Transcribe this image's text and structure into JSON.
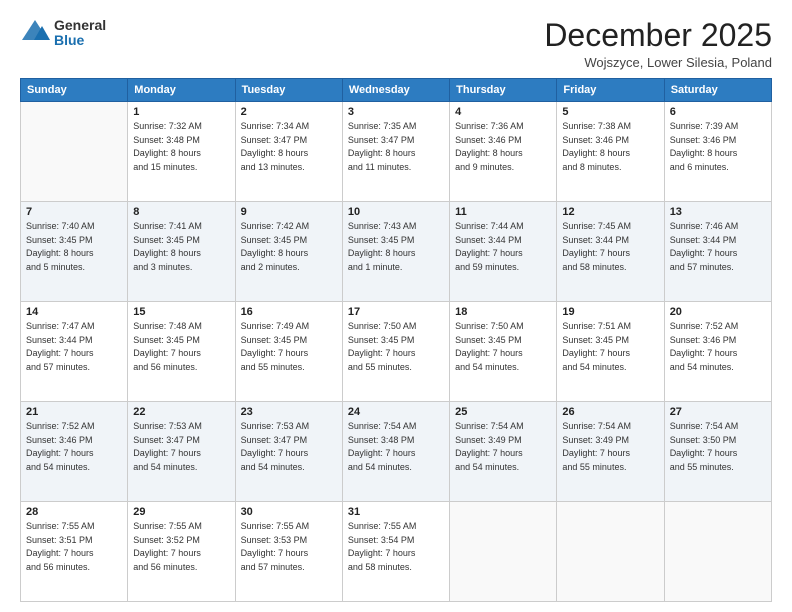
{
  "logo": {
    "general": "General",
    "blue": "Blue"
  },
  "header": {
    "month": "December 2025",
    "location": "Wojszyce, Lower Silesia, Poland"
  },
  "weekdays": [
    "Sunday",
    "Monday",
    "Tuesday",
    "Wednesday",
    "Thursday",
    "Friday",
    "Saturday"
  ],
  "weeks": [
    [
      {
        "day": "",
        "info": ""
      },
      {
        "day": "1",
        "info": "Sunrise: 7:32 AM\nSunset: 3:48 PM\nDaylight: 8 hours\nand 15 minutes."
      },
      {
        "day": "2",
        "info": "Sunrise: 7:34 AM\nSunset: 3:47 PM\nDaylight: 8 hours\nand 13 minutes."
      },
      {
        "day": "3",
        "info": "Sunrise: 7:35 AM\nSunset: 3:47 PM\nDaylight: 8 hours\nand 11 minutes."
      },
      {
        "day": "4",
        "info": "Sunrise: 7:36 AM\nSunset: 3:46 PM\nDaylight: 8 hours\nand 9 minutes."
      },
      {
        "day": "5",
        "info": "Sunrise: 7:38 AM\nSunset: 3:46 PM\nDaylight: 8 hours\nand 8 minutes."
      },
      {
        "day": "6",
        "info": "Sunrise: 7:39 AM\nSunset: 3:46 PM\nDaylight: 8 hours\nand 6 minutes."
      }
    ],
    [
      {
        "day": "7",
        "info": "Sunrise: 7:40 AM\nSunset: 3:45 PM\nDaylight: 8 hours\nand 5 minutes."
      },
      {
        "day": "8",
        "info": "Sunrise: 7:41 AM\nSunset: 3:45 PM\nDaylight: 8 hours\nand 3 minutes."
      },
      {
        "day": "9",
        "info": "Sunrise: 7:42 AM\nSunset: 3:45 PM\nDaylight: 8 hours\nand 2 minutes."
      },
      {
        "day": "10",
        "info": "Sunrise: 7:43 AM\nSunset: 3:45 PM\nDaylight: 8 hours\nand 1 minute."
      },
      {
        "day": "11",
        "info": "Sunrise: 7:44 AM\nSunset: 3:44 PM\nDaylight: 7 hours\nand 59 minutes."
      },
      {
        "day": "12",
        "info": "Sunrise: 7:45 AM\nSunset: 3:44 PM\nDaylight: 7 hours\nand 58 minutes."
      },
      {
        "day": "13",
        "info": "Sunrise: 7:46 AM\nSunset: 3:44 PM\nDaylight: 7 hours\nand 57 minutes."
      }
    ],
    [
      {
        "day": "14",
        "info": "Sunrise: 7:47 AM\nSunset: 3:44 PM\nDaylight: 7 hours\nand 57 minutes."
      },
      {
        "day": "15",
        "info": "Sunrise: 7:48 AM\nSunset: 3:45 PM\nDaylight: 7 hours\nand 56 minutes."
      },
      {
        "day": "16",
        "info": "Sunrise: 7:49 AM\nSunset: 3:45 PM\nDaylight: 7 hours\nand 55 minutes."
      },
      {
        "day": "17",
        "info": "Sunrise: 7:50 AM\nSunset: 3:45 PM\nDaylight: 7 hours\nand 55 minutes."
      },
      {
        "day": "18",
        "info": "Sunrise: 7:50 AM\nSunset: 3:45 PM\nDaylight: 7 hours\nand 54 minutes."
      },
      {
        "day": "19",
        "info": "Sunrise: 7:51 AM\nSunset: 3:45 PM\nDaylight: 7 hours\nand 54 minutes."
      },
      {
        "day": "20",
        "info": "Sunrise: 7:52 AM\nSunset: 3:46 PM\nDaylight: 7 hours\nand 54 minutes."
      }
    ],
    [
      {
        "day": "21",
        "info": "Sunrise: 7:52 AM\nSunset: 3:46 PM\nDaylight: 7 hours\nand 54 minutes."
      },
      {
        "day": "22",
        "info": "Sunrise: 7:53 AM\nSunset: 3:47 PM\nDaylight: 7 hours\nand 54 minutes."
      },
      {
        "day": "23",
        "info": "Sunrise: 7:53 AM\nSunset: 3:47 PM\nDaylight: 7 hours\nand 54 minutes."
      },
      {
        "day": "24",
        "info": "Sunrise: 7:54 AM\nSunset: 3:48 PM\nDaylight: 7 hours\nand 54 minutes."
      },
      {
        "day": "25",
        "info": "Sunrise: 7:54 AM\nSunset: 3:49 PM\nDaylight: 7 hours\nand 54 minutes."
      },
      {
        "day": "26",
        "info": "Sunrise: 7:54 AM\nSunset: 3:49 PM\nDaylight: 7 hours\nand 55 minutes."
      },
      {
        "day": "27",
        "info": "Sunrise: 7:54 AM\nSunset: 3:50 PM\nDaylight: 7 hours\nand 55 minutes."
      }
    ],
    [
      {
        "day": "28",
        "info": "Sunrise: 7:55 AM\nSunset: 3:51 PM\nDaylight: 7 hours\nand 56 minutes."
      },
      {
        "day": "29",
        "info": "Sunrise: 7:55 AM\nSunset: 3:52 PM\nDaylight: 7 hours\nand 56 minutes."
      },
      {
        "day": "30",
        "info": "Sunrise: 7:55 AM\nSunset: 3:53 PM\nDaylight: 7 hours\nand 57 minutes."
      },
      {
        "day": "31",
        "info": "Sunrise: 7:55 AM\nSunset: 3:54 PM\nDaylight: 7 hours\nand 58 minutes."
      },
      {
        "day": "",
        "info": ""
      },
      {
        "day": "",
        "info": ""
      },
      {
        "day": "",
        "info": ""
      }
    ]
  ]
}
